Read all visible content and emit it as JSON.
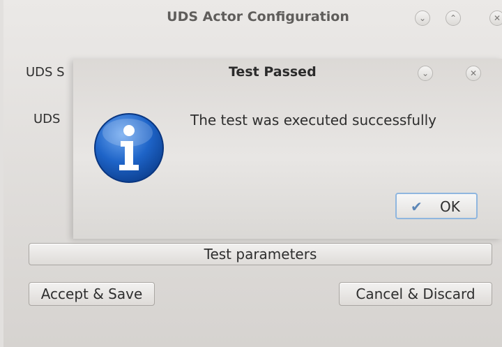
{
  "main_window": {
    "title": "UDS Actor Configuration",
    "label_server_truncated": "UDS S",
    "label_uds_truncated": "UDS",
    "test_button_label": "Test parameters",
    "accept_button_label": "Accept & Save",
    "cancel_button_label": "Cancel & Discard",
    "titlebar_buttons": {
      "minimize_glyph": "⌄",
      "maximize_glyph": "⌃",
      "close_glyph": "✕"
    }
  },
  "dialog": {
    "title": "Test Passed",
    "message": "The test was executed successfully",
    "ok_label": "OK",
    "ok_check_glyph": "✔",
    "minimize_glyph": "⌄",
    "close_glyph": "✕",
    "icon": "information-icon"
  },
  "colors": {
    "info_blue": "#1e64c8",
    "ok_focus_border": "#8fb6df"
  }
}
